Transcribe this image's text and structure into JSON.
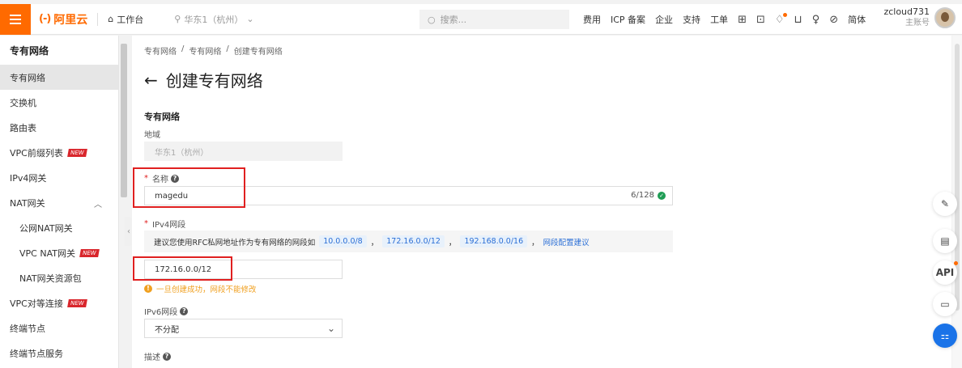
{
  "topbar": {
    "logo_text": "阿里云",
    "logo_mark": "(-)",
    "workbench": "工作台",
    "region": "华东1（杭州）",
    "search_placeholder": "搜索...",
    "links": [
      "费用",
      "ICP 备案",
      "企业",
      "支持",
      "工单"
    ],
    "user_name": "zcloud731",
    "user_role": "主账号"
  },
  "sidebar": {
    "title": "专有网络",
    "items": [
      {
        "label": "专有网络"
      },
      {
        "label": "交换机"
      },
      {
        "label": "路由表"
      },
      {
        "label": "VPC前缀列表",
        "badge": "NEW"
      },
      {
        "label": "IPv4网关"
      },
      {
        "label": "NAT网关"
      },
      {
        "label": "公网NAT网关"
      },
      {
        "label": "VPC NAT网关",
        "badge": "NEW"
      },
      {
        "label": "NAT网关资源包"
      },
      {
        "label": "VPC对等连接",
        "badge": "NEW"
      },
      {
        "label": "终端节点"
      },
      {
        "label": "终端节点服务"
      }
    ]
  },
  "main": {
    "breadcrumb": [
      "专有网络",
      "/",
      "专有网络",
      "/",
      "创建专有网络"
    ],
    "page_title": "创建专有网络",
    "back_arrow": "←",
    "section_title": "专有网络",
    "region_label": "地域",
    "region_value": "华东1（杭州）",
    "name_label": "名称",
    "name_value": "magedu",
    "name_counter": "6/128",
    "ipv4_label": "IPv4网段",
    "hint_text": "建议您使用RFC私网地址作为专有网络的网段如",
    "cidr_chips": [
      "10.0.0.0/8",
      "172.16.0.0/12",
      "192.168.0.0/16"
    ],
    "chip_sep": "，",
    "hint_link": "网段配置建议",
    "ipv4_value": "172.16.0.0/12",
    "warn_text": "一旦创建成功，网段不能修改",
    "ipv6_label": "IPv6网段",
    "ipv6_value": "不分配",
    "desc_label": "描述"
  },
  "float_buttons": [
    "edit-icon",
    "clipboard-edit-icon",
    "API",
    "message-icon",
    "apps-icon"
  ],
  "float_labels": {
    "api": "API"
  },
  "colors": {
    "brand": "#ff6a00",
    "link": "#2b6fd6",
    "highlight_box": "#e02020",
    "badge": "#d9262c"
  }
}
